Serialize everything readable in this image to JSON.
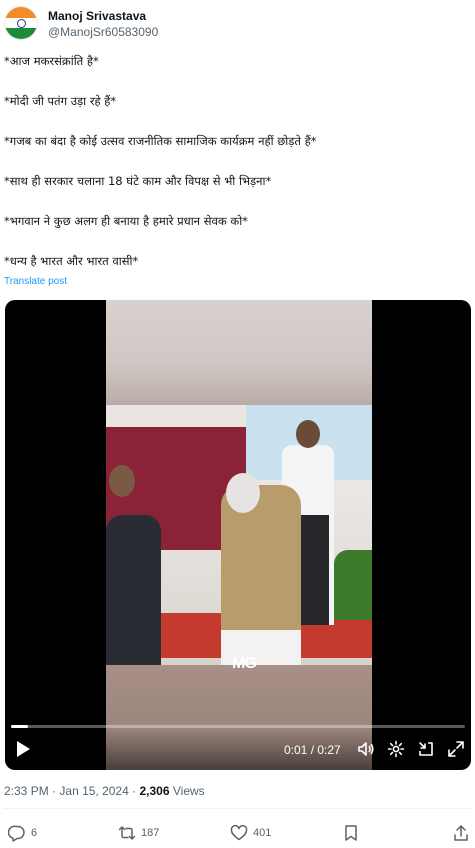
{
  "author": {
    "name": "Manoj Srivastava",
    "handle": "@ManojSr60583090"
  },
  "post": {
    "lines": [
      "*आज मकरसंक्रांति है*",
      "*मोदी जी पतंग उड़ा रहे हैं*",
      "*गजब का बंदा है कोई उत्सव राजनीतिक सामाजिक कार्यक्रम नहीं छोड़ते हैं*",
      "*साथ ही सरकार चलाना 18 घंटे काम और विपक्ष से भी भिड़ना*",
      "*भगवान ने कुछ अलग ही बनाया है हमारे प्रधान सेवक को*",
      "*धन्य है भारत और भारत वासी*"
    ],
    "translate_label": "Translate post"
  },
  "video": {
    "watermark": "MG",
    "current_time": "0:01",
    "duration": "0:27",
    "time_display": "0:01 / 0:27",
    "progress_fraction": 0.037
  },
  "meta": {
    "time": "2:33 PM",
    "date": "Jan 15, 2024",
    "separator": "·",
    "views": "2,306",
    "views_label": "Views"
  },
  "actions": {
    "replies": "6",
    "reposts": "187",
    "likes": "401"
  },
  "colors": {
    "accent": "#1d9bf0",
    "text": "#0f1419",
    "muted": "#536471"
  }
}
